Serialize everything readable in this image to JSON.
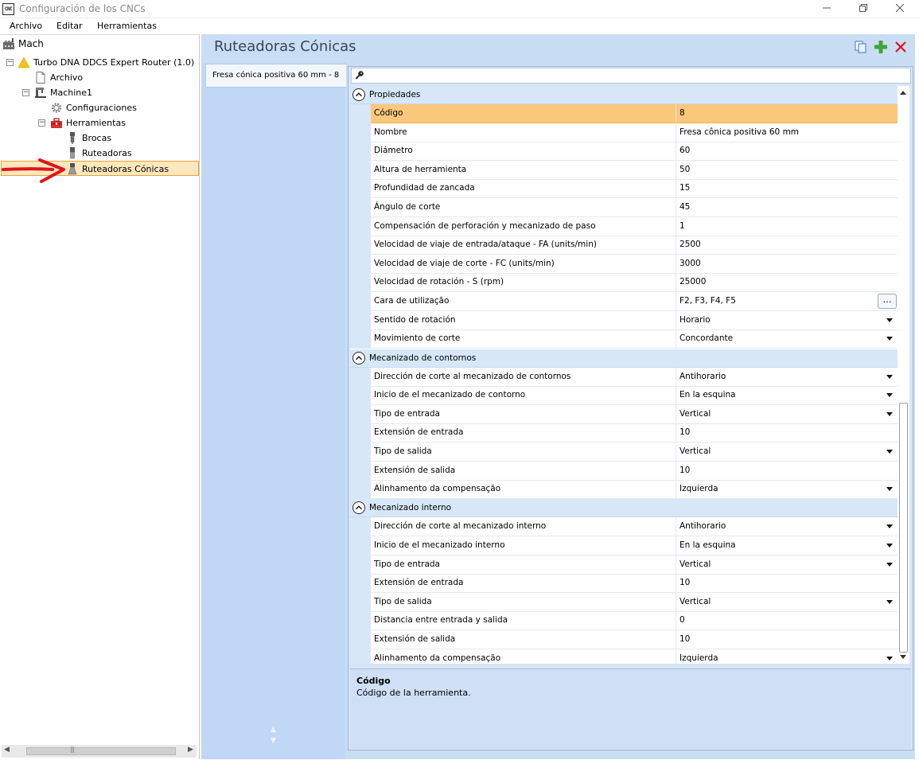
{
  "window": {
    "title": "Configuración de los CNCs",
    "icon_label": "CNC"
  },
  "menu": [
    "Archivo",
    "Editar",
    "Herramientas"
  ],
  "tree": {
    "root": "Mach",
    "machine_profile": "Turbo DNA DDCS Expert Router (1.0)",
    "archivo": "Archivo",
    "machine": "Machine1",
    "configuraciones": "Configuraciones",
    "herramientas": "Herramientas",
    "brocas": "Brocas",
    "ruteadoras": "Ruteadoras",
    "ruteadoras_conicas": "Ruteadoras Cónicas"
  },
  "panel": {
    "title": "Ruteadoras Cónicas",
    "tab_label": "Fresa cónica positiva 60 mm - 8",
    "search_placeholder": ""
  },
  "sections": {
    "propiedades": {
      "label": "Propiedades",
      "rows": [
        {
          "name": "Código",
          "value": "8"
        },
        {
          "name": "Nombre",
          "value": "Fresa cônica positiva 60 mm"
        },
        {
          "name": "Diámetro",
          "value": "60"
        },
        {
          "name": "Altura de herramienta",
          "value": "50"
        },
        {
          "name": "Profundidad de zancada",
          "value": "15"
        },
        {
          "name": "Ángulo de corte",
          "value": "45"
        },
        {
          "name": "Compensación de perforación y mecanizado de paso",
          "value": "1"
        },
        {
          "name": "Velocidad de viaje de entrada/ataque - FA (units/min)",
          "value": "2500"
        },
        {
          "name": "Velocidad de viaje de corte - FC (units/min)",
          "value": "3000"
        },
        {
          "name": "Velocidad de rotación - S (rpm)",
          "value": "25000"
        },
        {
          "name": "Cara de utilização",
          "value": "F2, F3, F4, F5"
        },
        {
          "name": "Sentido de rotación",
          "value": "Horario"
        },
        {
          "name": "Movimiento de corte",
          "value": "Concordante"
        }
      ]
    },
    "contornos": {
      "label": "Mecanizado de contornos",
      "rows": [
        {
          "name": "Dirección de corte al mecanizado de contornos",
          "value": "Antihorario"
        },
        {
          "name": "Inicio de el mecanizado de contorno",
          "value": "En la esquina"
        },
        {
          "name": "Tipo de entrada",
          "value": "Vertical"
        },
        {
          "name": "Extensión de entrada",
          "value": "10"
        },
        {
          "name": "Tipo de salida",
          "value": "Vertical"
        },
        {
          "name": "Extensión de salida",
          "value": "10"
        },
        {
          "name": "Alinhamento da compensação",
          "value": "Izquierda"
        }
      ]
    },
    "interno": {
      "label": "Mecanizado interno",
      "rows": [
        {
          "name": "Dirección de corte al mecanizado interno",
          "value": "Antihorario"
        },
        {
          "name": "Inicio de el mecanizado interno",
          "value": "En la esquina"
        },
        {
          "name": "Tipo de entrada",
          "value": "Vertical"
        },
        {
          "name": "Extensión de entrada",
          "value": "10"
        },
        {
          "name": "Tipo de salida",
          "value": "Vertical"
        },
        {
          "name": "Distancia entre entrada y salida",
          "value": "0"
        },
        {
          "name": "Extensión de salida",
          "value": "10"
        },
        {
          "name": "Alinhamento da compensação",
          "value": "Izquierda"
        }
      ]
    }
  },
  "help": {
    "title": "Código",
    "description": "Código de la herramienta."
  },
  "colors": {
    "selection": "#fbc77b",
    "panel_bg": "#c9ddf5",
    "annotation_arrow": "#e0141b"
  }
}
